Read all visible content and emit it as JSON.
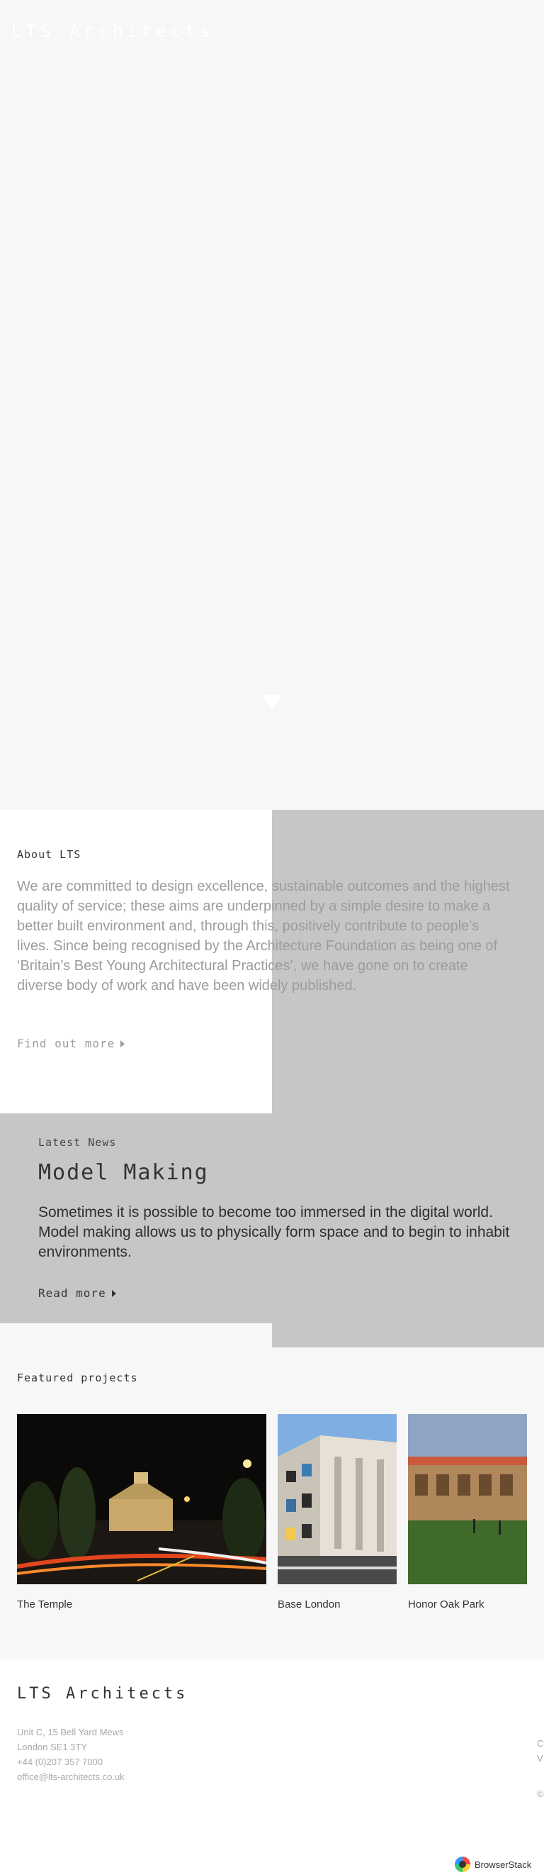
{
  "header": {
    "logo": "LTS Architects"
  },
  "about": {
    "heading": "About LTS",
    "text": "We are committed to design excellence, sustainable outcomes and the highest quality of service; these aims are underpinned by a simple desire to make a better built environment and, through this, positively contribute to people’s lives. Since being recognised by the Architecture Foundation as being one of ‘Britain’s Best Young Architectural Practices’, we have gone on to create diverse body of work and have been widely published.",
    "link_label": "Find out more"
  },
  "news": {
    "label": "Latest News",
    "title": "Model Making",
    "text": "Sometimes it is possible to become too immersed in the digital world. Model making allows us to physically form space and to begin to inhabit environments.",
    "link_label": "Read more"
  },
  "projects": {
    "heading": "Featured projects",
    "items": [
      {
        "title": "The Temple"
      },
      {
        "title": "Base London"
      },
      {
        "title": "Honor Oak Park"
      }
    ]
  },
  "footer": {
    "logo": "LTS Architects",
    "address_line1": "Unit C, 15 Bell Yard Mews",
    "address_line2": "London SE1 3TY",
    "phone": "+44 (0)207 357 7000",
    "email": "office@lts-architects.co.uk",
    "side_line1": "C",
    "side_line2": "V",
    "side_line3": "©"
  },
  "badge": {
    "label": "BrowserStack"
  },
  "colors": {
    "grey_panel": "#c6c6c6",
    "background": "#f7f7f7",
    "muted_text": "#9c9c9c"
  }
}
